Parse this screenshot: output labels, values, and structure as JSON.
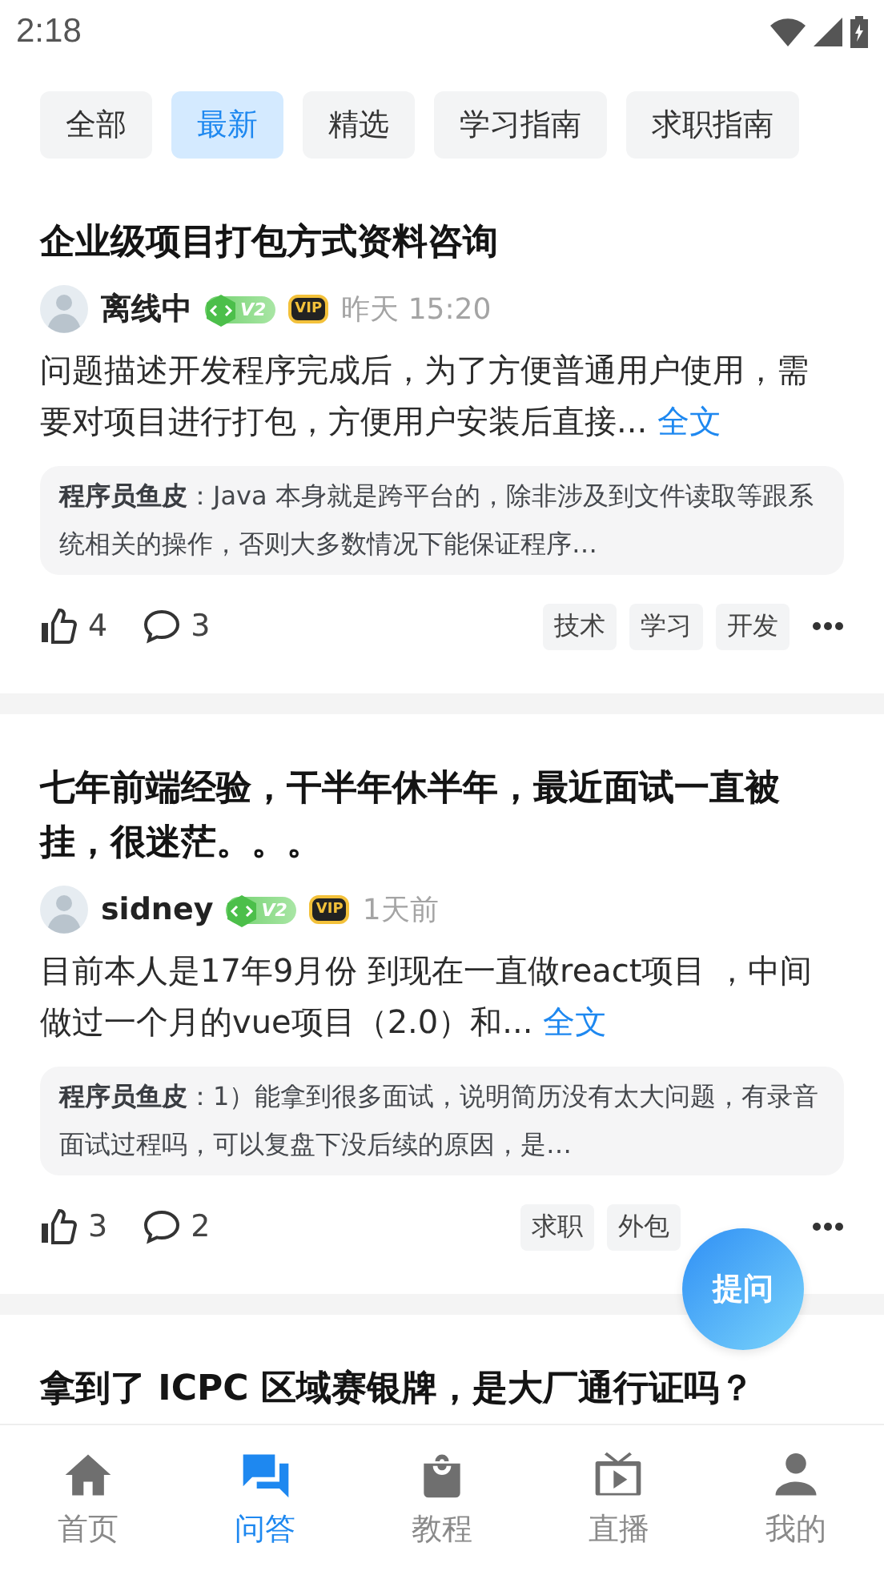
{
  "status_bar": {
    "time": "2:18"
  },
  "tabs": [
    {
      "label": "全部",
      "selected": false
    },
    {
      "label": "最新",
      "selected": true
    },
    {
      "label": "精选",
      "selected": false
    },
    {
      "label": "学习指南",
      "selected": false
    },
    {
      "label": "求职指南",
      "selected": false
    }
  ],
  "posts": [
    {
      "title": "企业级项目打包方式资料咨询",
      "author": "离线中",
      "rank_badge": "V2",
      "vip_badge": "VIP",
      "time": "昨天 15:20",
      "excerpt": "问题描述开发程序完成后，为了方便普通用户使用，需要对项目进行打包，方便用户安装后直接...",
      "more_link": "全文",
      "reply": "**程序员鱼皮**：Java 本身就是跨平台的，除非涉及到文件读取等跟系统相关的操作，否则大多数情况下能保证程序…",
      "likes": "4",
      "comments": "3",
      "tags": [
        "技术",
        "学习",
        "开发"
      ]
    },
    {
      "title": "七年前端经验，干半年休半年，最近面试一直被挂，很迷茫。。。",
      "author": "sidney",
      "rank_badge": "V2",
      "vip_badge": "VIP",
      "time": "1天前",
      "excerpt": "目前本人是17年9月份 到现在一直做react项目 ，中间做过一个月的vue项目（2.0）和...",
      "more_link": "全文",
      "reply": "**程序员鱼皮**：1）能拿到很多面试，说明简历没有太大问题，有录音面试过程吗，可以复盘下没后续的原因，是…",
      "likes": "3",
      "comments": "2",
      "tags": [
        "求职",
        "外包"
      ]
    },
    {
      "title": "拿到了 ICPC 区域赛银牌，是大厂通行证吗？"
    }
  ],
  "ask_button": "提问",
  "nav": [
    {
      "label": "首页",
      "selected": false
    },
    {
      "label": "问答",
      "selected": true
    },
    {
      "label": "教程",
      "selected": false
    },
    {
      "label": "直播",
      "selected": false
    },
    {
      "label": "我的",
      "selected": false
    }
  ]
}
